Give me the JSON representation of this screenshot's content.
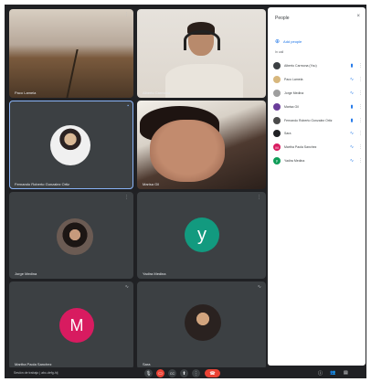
{
  "tiles": [
    {
      "id": "road",
      "name": "Paco Lamela"
    },
    {
      "id": "man",
      "name": "Alberto Carmona"
    },
    {
      "id": "pinned",
      "name": "Fernando Roberto Gonzalez Ortiz"
    },
    {
      "id": "woman",
      "name": "Marisa Gil"
    },
    {
      "id": "avatar-photo",
      "name": "Jorge Medina"
    },
    {
      "id": "y",
      "name": "Yadira Medina",
      "letter": "y"
    },
    {
      "id": "m",
      "name": "Martha Paola Sanchez",
      "letter": "M"
    },
    {
      "id": "last",
      "name": "Sara"
    }
  ],
  "panel": {
    "title": "People",
    "close": "×",
    "add_label": "Add people",
    "section": "In call",
    "participants": [
      {
        "name": "Alberto Carmona (You)",
        "avatar_color": "#3c4043",
        "letter": "",
        "mic": "▮",
        "pin": "⋮"
      },
      {
        "name": "Paco Lamela",
        "avatar_color": "#d7b77d",
        "letter": "",
        "mic": "∿",
        "pin": "⋮"
      },
      {
        "name": "Jorge Medina",
        "avatar_color": "#9e9e9e",
        "letter": "",
        "mic": "∿",
        "pin": "⋮"
      },
      {
        "name": "Marisa Gil",
        "avatar_color": "#6a3d9a",
        "letter": "",
        "mic": "▮",
        "pin": "⋮"
      },
      {
        "name": "Fernando Roberto Gonzalez Ortiz",
        "avatar_color": "#4a4a4a",
        "letter": "",
        "mic": "▮",
        "pin": "⋮"
      },
      {
        "name": "Sara",
        "avatar_color": "#202124",
        "letter": "",
        "mic": "∿",
        "pin": "⋮"
      },
      {
        "name": "Martha Paola Sanchez",
        "avatar_color": "#d81b60",
        "letter": "M",
        "mic": "∿",
        "pin": "⋮"
      },
      {
        "name": "Yadira Medina",
        "avatar_color": "#0f9d58",
        "letter": "y",
        "mic": "∿",
        "pin": "⋮"
      }
    ]
  },
  "bottombar": {
    "meeting_info": "Sesión de trabajo | abc-defg-hij",
    "mic_icon": "🎙",
    "cam_icon": "▭",
    "cc_icon": "CC",
    "present_icon": "⬆",
    "more_icon": "⋮",
    "end_icon": "☎",
    "info_icon": "ⓘ",
    "people_icon": "👥",
    "chat_icon": "▤"
  },
  "colors": {
    "background": "#202124",
    "tile": "#3c4043",
    "accent": "#8ab4f8",
    "end": "#ea4335"
  }
}
